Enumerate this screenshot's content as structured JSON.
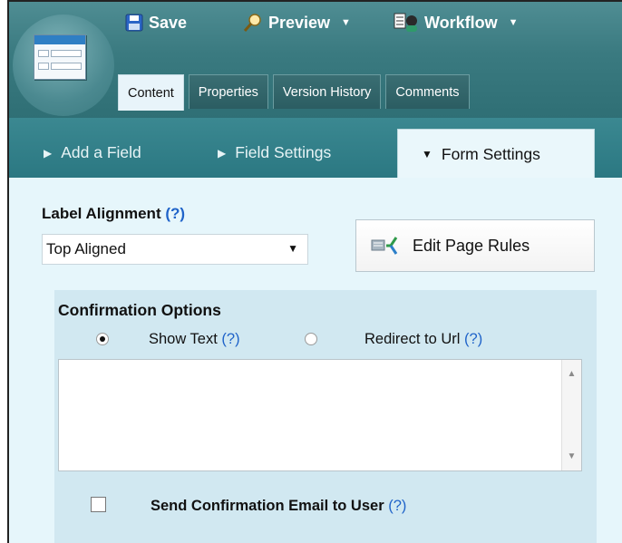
{
  "toolbar": {
    "save_label": "Save",
    "preview_label": "Preview",
    "workflow_label": "Workflow"
  },
  "tabs": [
    {
      "label": "Content",
      "active": true
    },
    {
      "label": "Properties",
      "active": false
    },
    {
      "label": "Version History",
      "active": false
    },
    {
      "label": "Comments",
      "active": false
    }
  ],
  "subtabs": [
    {
      "label": "Add a Field",
      "active": false
    },
    {
      "label": "Field Settings",
      "active": false
    },
    {
      "label": "Form Settings",
      "active": true
    }
  ],
  "form_settings": {
    "label_alignment": {
      "label": "Label Alignment",
      "help": "(?)",
      "selected": "Top Aligned"
    },
    "edit_page_rules_label": "Edit Page Rules",
    "confirmation": {
      "title": "Confirmation Options",
      "show_text_label": "Show Text",
      "show_text_help": "(?)",
      "show_text_selected": true,
      "redirect_label": "Redirect to Url",
      "redirect_help": "(?)",
      "redirect_selected": false,
      "text_value": ""
    },
    "send_email": {
      "label": "Send Confirmation Email to User",
      "help": "(?)",
      "checked": false
    }
  },
  "colors": {
    "toolbar": "#3a7a80",
    "subbar": "#2b7882",
    "panel": "#e6f6fb",
    "confirm_box": "#d1e8f1",
    "help_link": "#1f63c9"
  },
  "icons": [
    "floppy-disk-icon",
    "magnifier-icon",
    "workflow-icon",
    "page-rules-icon",
    "form-app-icon"
  ]
}
